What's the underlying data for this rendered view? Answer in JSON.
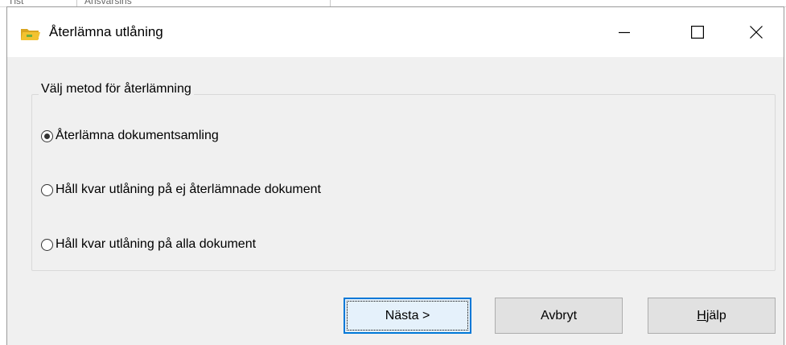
{
  "background": {
    "fragments": [
      "Tlst",
      "Ansvarsins"
    ]
  },
  "window": {
    "title": "Återlämna utlåning",
    "icon": "folder-open-icon",
    "controls": {
      "minimize": "minimize-icon",
      "maximize": "maximize-icon",
      "close": "close-icon"
    }
  },
  "group": {
    "legend": "Välj metod för återlämning",
    "options": [
      {
        "label": "Återlämna dokumentsamling",
        "selected": true
      },
      {
        "label": "Håll kvar utlåning på ej återlämnade dokument",
        "selected": false
      },
      {
        "label": "Håll kvar utlåning på alla dokument",
        "selected": false
      }
    ]
  },
  "buttons": {
    "next": "Nästa >",
    "cancel": "Avbryt",
    "help_mnemonic": "H",
    "help_rest": "jälp"
  },
  "colors": {
    "accent": "#0078d7",
    "dialog_bg": "#f0f0f0",
    "button_bg": "#e1e1e1",
    "icon_folder": "#f2c230"
  }
}
